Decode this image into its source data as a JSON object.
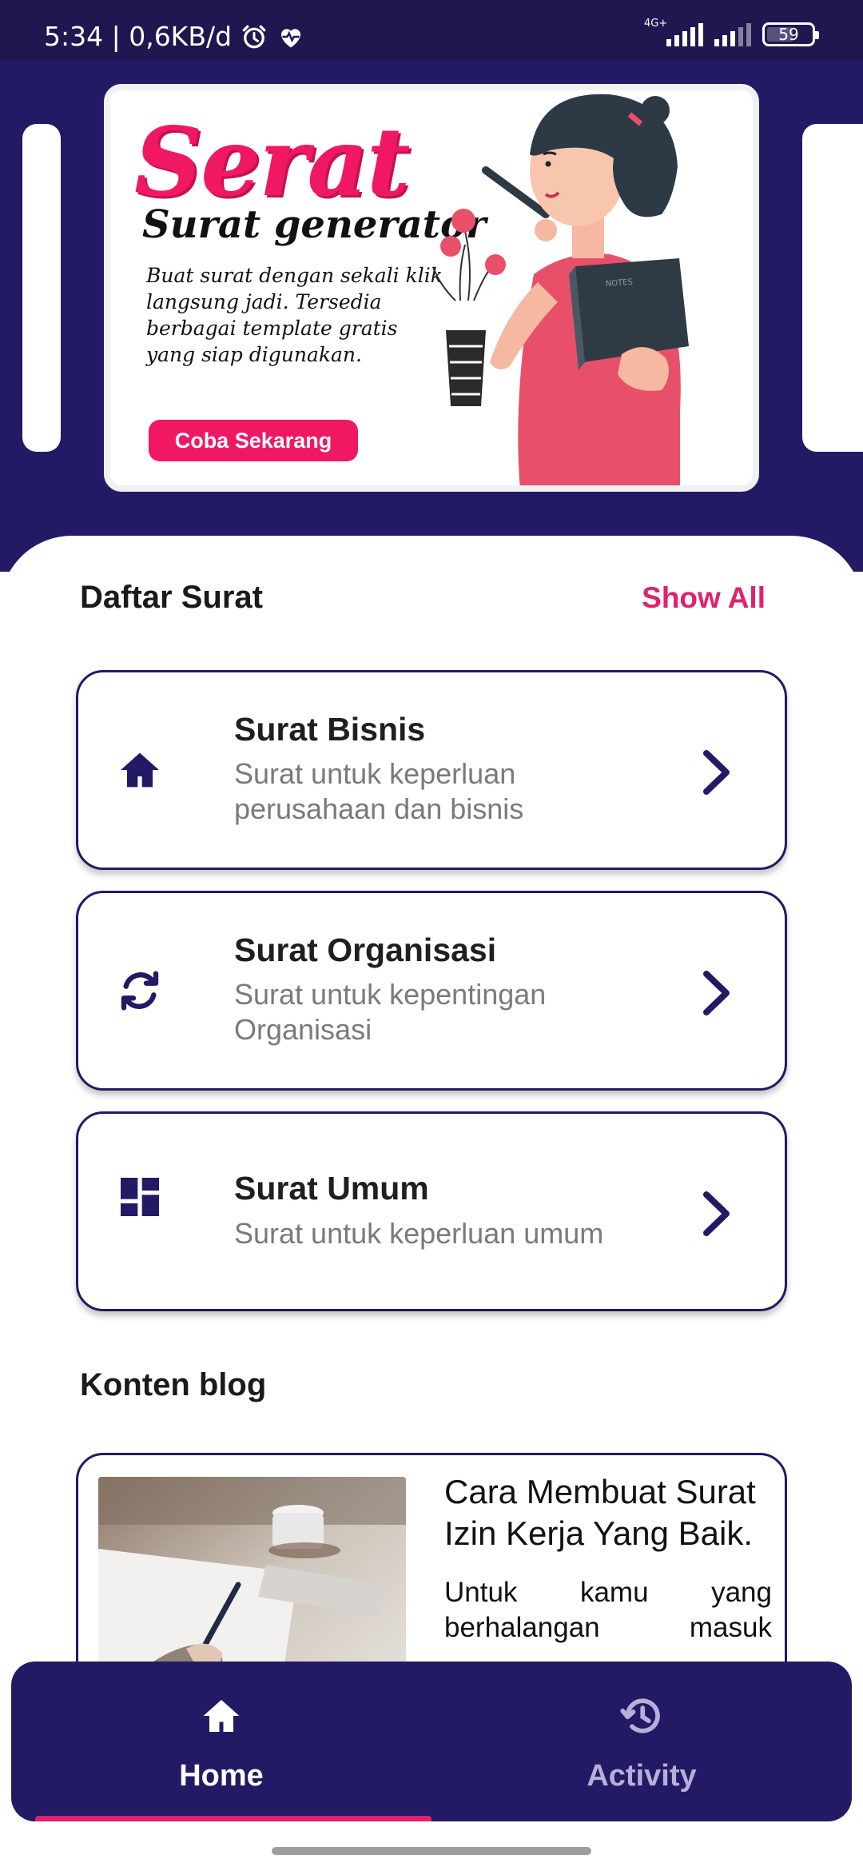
{
  "status_bar": {
    "time_info": "5:34 | 0,6KB/d",
    "network": "4G+",
    "battery": "59",
    "battery_level": 0.59,
    "icons": [
      "alarm-icon",
      "heart-pulse-icon",
      "signal-icon",
      "battery-icon"
    ]
  },
  "banner": {
    "title": "Serat",
    "subtitle": "Surat generator",
    "description": "Buat surat dengan sekali klik langsung jadi. Tersedia berbagai template gratis yang siap digunakan.",
    "cta": "Coba Sekarang"
  },
  "letters_section": {
    "title": "Daftar Surat",
    "show_all": "Show All",
    "items": [
      {
        "icon": "home-icon",
        "title": "Surat Bisnis",
        "description": "Surat untuk keperluan perusahaan dan bisnis"
      },
      {
        "icon": "sync-icon",
        "title": "Surat Organisasi",
        "description": "Surat untuk kepentingan Organisasi"
      },
      {
        "icon": "dashboard-icon",
        "title": "Surat Umum",
        "description": "Surat untuk keperluan umum"
      }
    ]
  },
  "blog_section": {
    "title": "Konten blog",
    "posts": [
      {
        "title": "Cara Membuat Surat Izin Kerja Yang Baik.",
        "excerpt": "Untuk kamu yang berhalangan masuk"
      }
    ]
  },
  "bottom_nav": {
    "items": [
      {
        "icon": "home-icon",
        "label": "Home",
        "active": true
      },
      {
        "icon": "history-icon",
        "label": "Activity",
        "active": false
      }
    ]
  },
  "colors": {
    "primary": "#231a66",
    "accent": "#e0226c",
    "status_bar": "#1f1850"
  }
}
